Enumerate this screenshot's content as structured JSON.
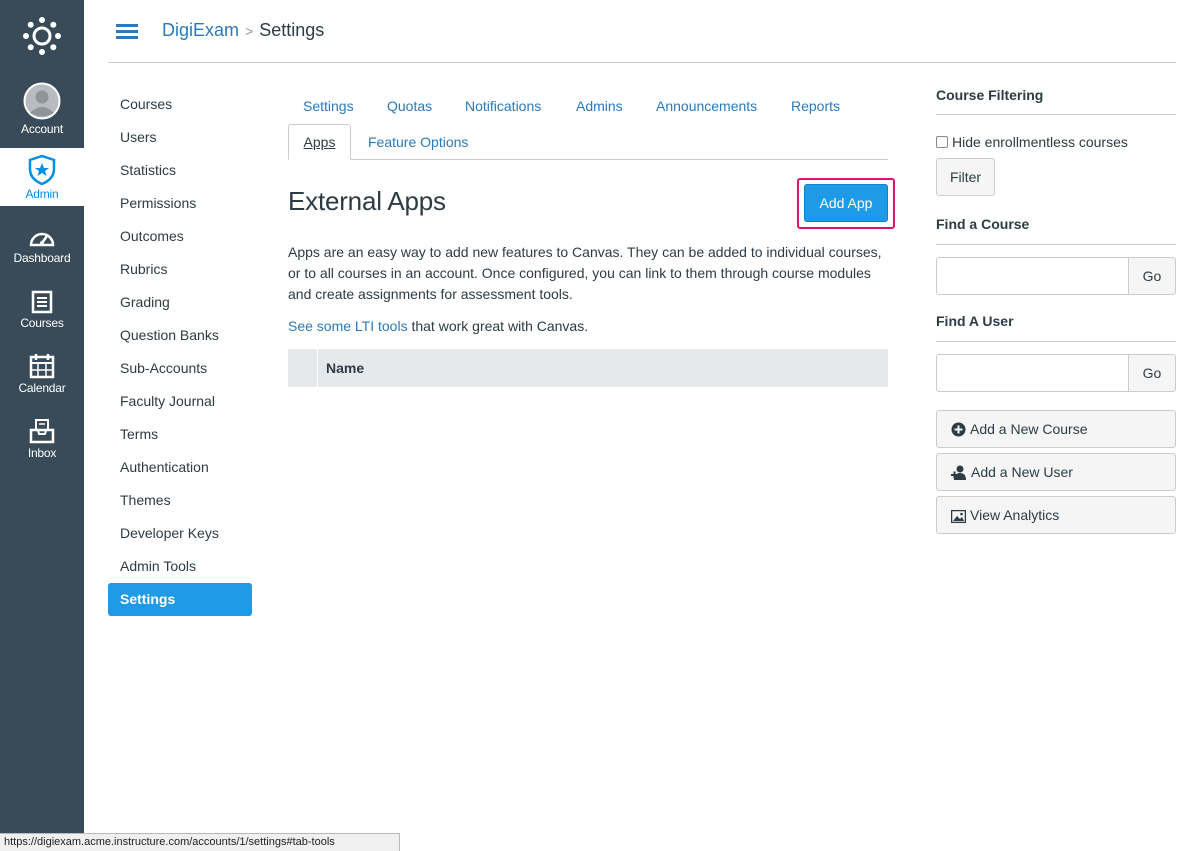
{
  "global_nav": {
    "account": "Account",
    "admin": "Admin",
    "dashboard": "Dashboard",
    "courses": "Courses",
    "calendar": "Calendar",
    "inbox": "Inbox"
  },
  "breadcrumb": {
    "account": "DigiExam",
    "separator": ">",
    "current": "Settings"
  },
  "sidebar": {
    "items": [
      {
        "label": "Courses"
      },
      {
        "label": "Users"
      },
      {
        "label": "Statistics"
      },
      {
        "label": "Permissions"
      },
      {
        "label": "Outcomes"
      },
      {
        "label": "Rubrics"
      },
      {
        "label": "Grading"
      },
      {
        "label": "Question Banks"
      },
      {
        "label": "Sub-Accounts"
      },
      {
        "label": "Faculty Journal"
      },
      {
        "label": "Terms"
      },
      {
        "label": "Authentication"
      },
      {
        "label": "Themes"
      },
      {
        "label": "Developer Keys"
      },
      {
        "label": "Admin Tools"
      },
      {
        "label": "Settings",
        "active": true
      }
    ]
  },
  "tabs": {
    "settings": "Settings",
    "quotas": "Quotas",
    "notifications": "Notifications",
    "admins": "Admins",
    "announcements": "Announcements",
    "reports": "Reports",
    "apps": "Apps",
    "feature_options": "Feature Options",
    "active": "Apps"
  },
  "external_apps": {
    "title": "External Apps",
    "add_button": "Add App",
    "description": "Apps are an easy way to add new features to Canvas. They can be added to individual courses, or to all courses in an account. Once configured, you can link to them through course modules and create assignments for assessment tools.",
    "lti_link": "See some LTI tools",
    "lti_suffix": " that work great with Canvas.",
    "table_header_name": "Name"
  },
  "right_sidebar": {
    "course_filtering": "Course Filtering",
    "hide_enrollmentless": "Hide enrollmentless courses",
    "hide_enrollmentless_checked": false,
    "filter_button": "Filter",
    "find_course": "Find a Course",
    "find_course_value": "",
    "find_user": "Find A User",
    "find_user_value": "",
    "go": "Go",
    "add_course": "Add a New Course",
    "add_user": "Add a New User",
    "view_analytics": "View Analytics"
  },
  "status_bar": {
    "url": "https://digiexam.acme.instructure.com/accounts/1/settings#tab-tools"
  },
  "colors": {
    "nav_bg": "#394b58",
    "link": "#2a7abc",
    "primary": "#1f9ae6",
    "highlight_frame": "#d6196f"
  }
}
